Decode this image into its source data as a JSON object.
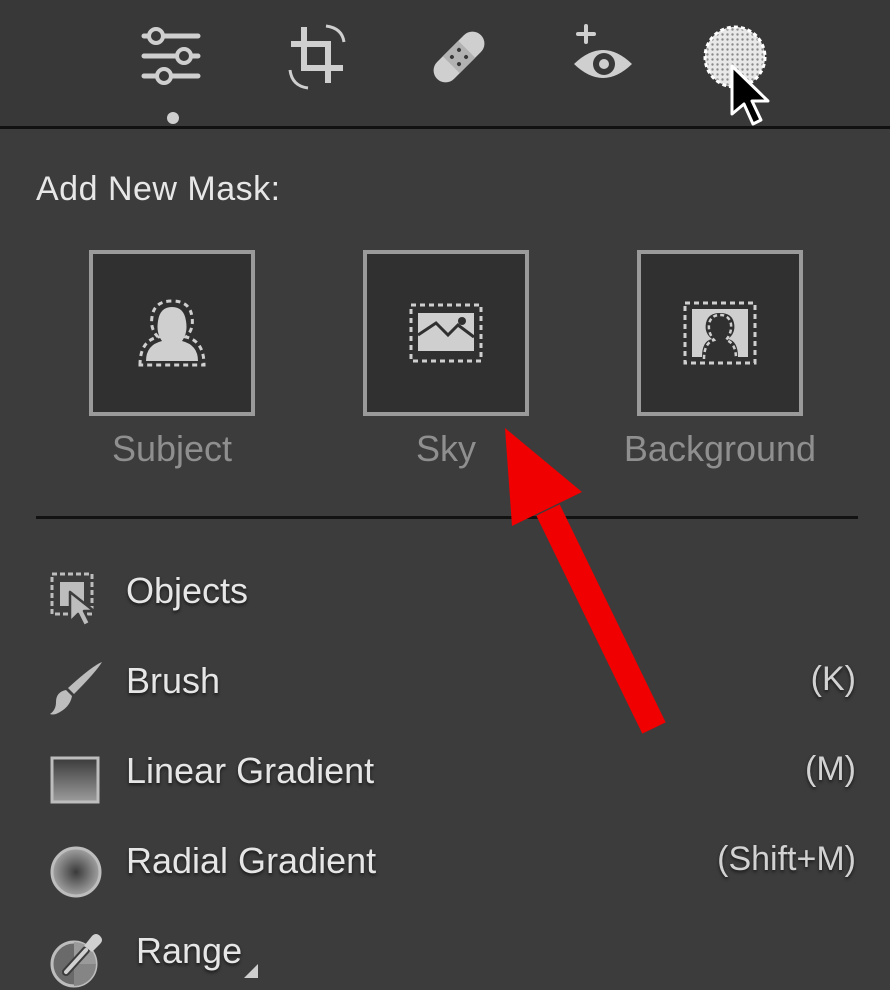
{
  "toolbar": {
    "tools": [
      {
        "icon": "edit-sliders-icon",
        "active": true
      },
      {
        "icon": "crop-icon",
        "active": false
      },
      {
        "icon": "healing-bandage-icon",
        "active": false
      },
      {
        "icon": "red-eye-icon",
        "active": false
      },
      {
        "icon": "masking-icon",
        "active": false
      }
    ]
  },
  "mask_panel": {
    "title": "Add New Mask:",
    "quick_masks": [
      {
        "label": "Subject",
        "icon": "subject-person-icon"
      },
      {
        "label": "Sky",
        "icon": "sky-landscape-icon"
      },
      {
        "label": "Background",
        "icon": "background-person-icon"
      }
    ],
    "tools": [
      {
        "label": "Objects",
        "shortcut": "",
        "icon": "objects-select-icon"
      },
      {
        "label": "Brush",
        "shortcut": "(K)",
        "icon": "brush-icon"
      },
      {
        "label": "Linear Gradient",
        "shortcut": "(M)",
        "icon": "linear-gradient-icon"
      },
      {
        "label": "Radial Gradient",
        "shortcut": "(Shift+M)",
        "icon": "radial-gradient-icon"
      },
      {
        "label": "Range",
        "shortcut": "",
        "icon": "range-eyedropper-icon"
      }
    ]
  },
  "annotation": {
    "color": "#f00000",
    "points_to": "Sky"
  },
  "colors": {
    "panel_bg": "#3c3c3c",
    "toolbar_bg": "#383838",
    "tile_border": "#9a9a9a",
    "label_dim": "#8f8f8f"
  }
}
